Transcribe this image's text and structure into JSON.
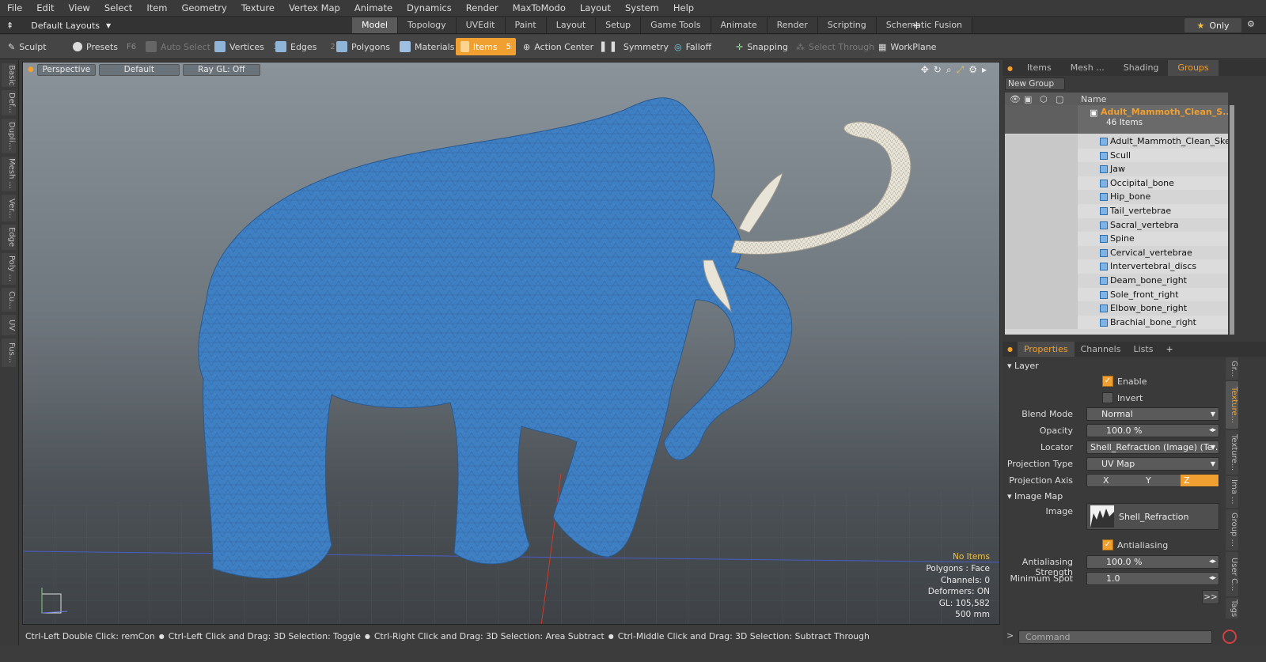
{
  "menu": [
    "File",
    "Edit",
    "View",
    "Select",
    "Item",
    "Geometry",
    "Texture",
    "Vertex Map",
    "Animate",
    "Dynamics",
    "Render",
    "MaxToModo",
    "Layout",
    "System",
    "Help"
  ],
  "layout": {
    "selector": "Default Layouts",
    "tabs": [
      "Model",
      "Topology",
      "UVEdit",
      "Paint",
      "Layout",
      "Setup",
      "Game Tools",
      "Animate",
      "Render",
      "Scripting",
      "Schematic Fusion"
    ],
    "active_tab": "Model",
    "only_label": "Only"
  },
  "toolbar": {
    "sculpt": "Sculpt",
    "presets": "Presets",
    "presets_key": "F6",
    "auto_select": "Auto Select",
    "vertices": "Vertices",
    "vertices_key": "1",
    "edges": "Edges",
    "edges_key": "2",
    "polygons": "Polygons",
    "materials": "Materials",
    "items": "Items",
    "items_key": "5",
    "action_center": "Action Center",
    "symmetry": "Symmetry",
    "falloff": "Falloff",
    "snapping": "Snapping",
    "select_through": "Select Through",
    "workplane": "WorkPlane"
  },
  "left_tabs": [
    "Basic",
    "Def...",
    "Dupli...",
    "Mesh ...",
    "Ver...",
    "Edge",
    "Poly ...",
    "Cu...",
    "UV",
    "Fus..."
  ],
  "viewport": {
    "view": "Perspective",
    "shading": "Default",
    "raygl": "Ray GL: Off",
    "info": {
      "items": "No Items",
      "polygons": "Polygons : Face",
      "channels": "Channels: 0",
      "deformers": "Deformers: ON",
      "gl": "GL: 105,582",
      "scale": "500 mm"
    }
  },
  "status": {
    "hints": [
      "Ctrl-Left Double Click: remCon",
      "Ctrl-Left Click and Drag: 3D Selection: Toggle",
      "Ctrl-Right Click and Drag: 3D Selection: Area Subtract",
      "Ctrl-Middle Click and Drag: 3D Selection: Subtract Through"
    ]
  },
  "items_panel": {
    "tabs": [
      "Items",
      "Mesh ...",
      "Shading",
      "Groups"
    ],
    "active_tab": "Groups",
    "new_group": "New Group",
    "name_header": "Name",
    "group": {
      "name": "Adult_Mammoth_Clean_S...",
      "count": "46 Items"
    },
    "rows": [
      "Adult_Mammoth_Clean_Skel...",
      "Scull",
      "Jaw",
      "Occipital_bone",
      "Hip_bone",
      "Tail_vertebrae",
      "Sacral_vertebra",
      "Spine",
      "Cervical_vertebrae",
      "Intervertebral_discs",
      "Deam_bone_right",
      "Sole_front_right",
      "Elbow_bone_right",
      "Brachial_bone_right"
    ]
  },
  "props_panel": {
    "tabs": [
      "Properties",
      "Channels",
      "Lists"
    ],
    "active_tab": "Properties",
    "layer_section": "Layer",
    "enable": "Enable",
    "invert": "Invert",
    "blend_mode_label": "Blend Mode",
    "blend_mode": "Normal",
    "opacity_label": "Opacity",
    "opacity": "100.0 %",
    "locator_label": "Locator",
    "locator": "Shell_Refraction (Image) (Te ...",
    "projection_type_label": "Projection Type",
    "projection_type": "UV Map",
    "projection_axis_label": "Projection Axis",
    "axis_x": "X",
    "axis_y": "Y",
    "axis_z": "Z",
    "active_axis": "Z",
    "image_map_section": "Image Map",
    "image_label": "Image",
    "image": "Shell_Refraction",
    "antialiasing": "Antialiasing",
    "aa_strength_label": "Antialiasing Strength",
    "aa_strength": "100.0 %",
    "min_spot_label": "Minimum Spot",
    "min_spot": "1.0",
    "more": ">>"
  },
  "side_tabs": [
    "Gr...",
    "Texture...",
    "Texture...",
    "Ima ...",
    "Group ...",
    "User C...",
    "Tags"
  ],
  "command": {
    "placeholder": "Command"
  },
  "colors": {
    "accent": "#f0a030",
    "mesh": "#3f7fc4",
    "tusk": "#e8e4d8"
  }
}
